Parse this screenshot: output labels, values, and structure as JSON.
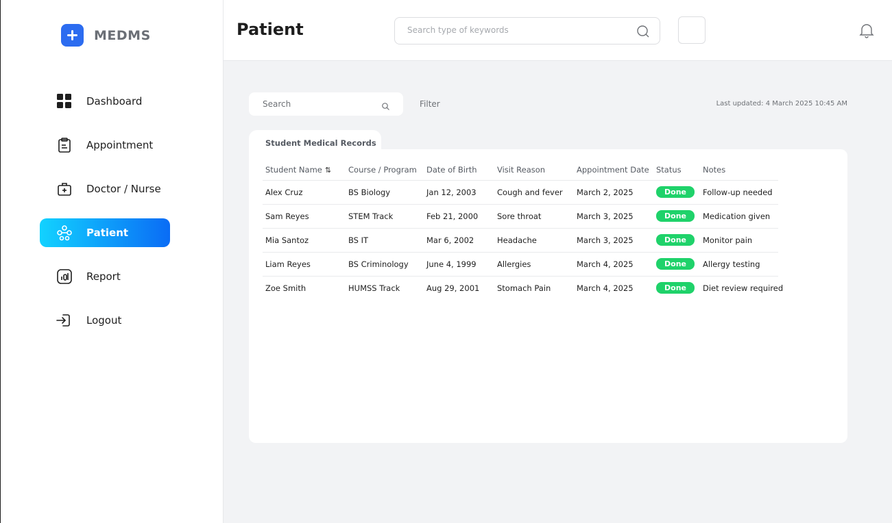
{
  "app": {
    "name": "MEDMS"
  },
  "sidebar": {
    "items": [
      {
        "label": "Dashboard",
        "icon": "grid-icon",
        "active": false
      },
      {
        "label": "Appointment",
        "icon": "clipboard-icon",
        "active": false
      },
      {
        "label": "Doctor / Nurse",
        "icon": "medical-kit-icon",
        "active": false
      },
      {
        "label": "Patient",
        "icon": "patient-icon",
        "active": true
      },
      {
        "label": "Report",
        "icon": "report-chart-icon",
        "active": false
      },
      {
        "label": "Logout",
        "icon": "logout-icon",
        "active": false
      }
    ]
  },
  "header": {
    "title": "Patient",
    "search_placeholder": "Search type of keywords"
  },
  "toolbar": {
    "search_placeholder": "Search",
    "filter_label": "Filter",
    "last_updated": "Last updated: 4 March 2025 10:45 AM"
  },
  "records": {
    "tab_label": "Student Medical Records",
    "columns": [
      "Student Name",
      "Course / Program",
      "Date of Birth",
      "Visit Reason",
      "Appointment Date",
      "Status",
      "Notes"
    ],
    "rows": [
      [
        "Alex Cruz",
        "BS Biology",
        "Jan 12, 2003",
        "Cough and fever",
        "March 2, 2025",
        "Done",
        "Follow-up needed"
      ],
      [
        "Sam Reyes",
        "STEM Track",
        "Feb 21, 2000",
        "Sore throat",
        "March 3, 2025",
        "Done",
        "Medication given"
      ],
      [
        "Mia Santoz",
        "BS IT",
        "Mar 6, 2002",
        "Headache",
        "March 3, 2025",
        "Done",
        "Monitor pain"
      ],
      [
        "Liam Reyes",
        "BS Criminology",
        "June 4, 1999",
        "Allergies",
        "March 4, 2025",
        "Done",
        "Allergy testing"
      ],
      [
        "Zoe Smith",
        "HUMSS Track",
        "Aug 29, 2001",
        "Stomach Pain",
        "March 4, 2025",
        "Done",
        "Diet review required"
      ]
    ]
  },
  "colors": {
    "accent_gradient_start": "#12d2ff",
    "accent_gradient_end": "#0a6cf5",
    "brand": "#2c6cf0",
    "status_done": "#1fd26a"
  }
}
